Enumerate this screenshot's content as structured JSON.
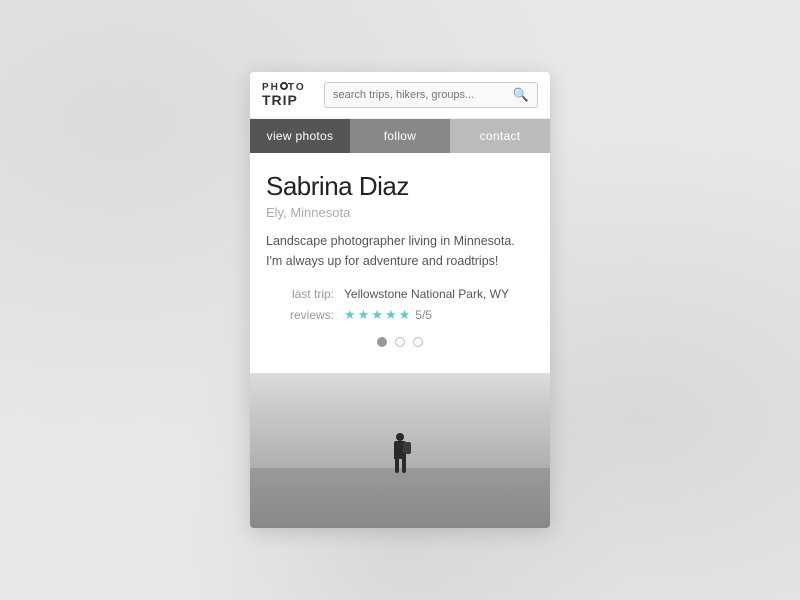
{
  "app": {
    "logo_photo": "PH TO",
    "logo_trip": "TRIP"
  },
  "search": {
    "placeholder": "search trips, hikers, groups..."
  },
  "buttons": {
    "view_photos": "view photos",
    "follow": "follow",
    "contact": "contact"
  },
  "profile": {
    "name": "Sabrina Diaz",
    "location": "Ely, Minnesota",
    "bio": "Landscape photographer living in Minnesota. I'm always up for adventure and roadtrips!",
    "last_trip_label": "last trip:",
    "last_trip_value": "Yellowstone National Park, WY",
    "reviews_label": "reviews:",
    "reviews_score": "5/5",
    "stars_filled": 5,
    "stars_total": 5
  },
  "pagination": {
    "dots": [
      {
        "active": true
      },
      {
        "active": false
      },
      {
        "active": false
      }
    ]
  }
}
